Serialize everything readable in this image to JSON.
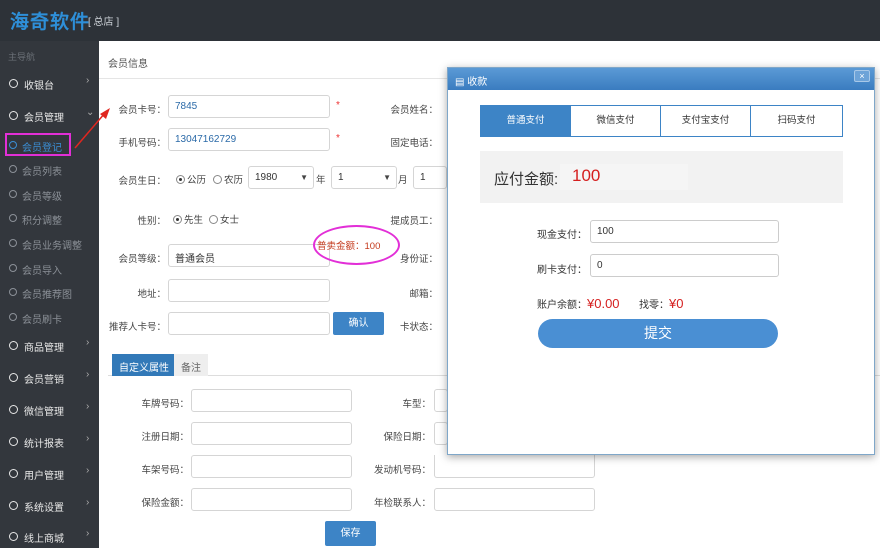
{
  "header": {
    "brand": "海奇软件",
    "store": "[ 总店 ]"
  },
  "sidebar": {
    "title": "主导航",
    "groups": [
      {
        "label": "收银台"
      },
      {
        "label": "会员管理"
      },
      {
        "label": "商品管理"
      },
      {
        "label": "会员营销"
      },
      {
        "label": "微信管理"
      },
      {
        "label": "统计报表"
      },
      {
        "label": "用户管理"
      },
      {
        "label": "系统设置"
      },
      {
        "label": "线上商城"
      }
    ],
    "subitems": [
      {
        "label": "会员登记"
      },
      {
        "label": "会员列表"
      },
      {
        "label": "会员等级"
      },
      {
        "label": "积分调整"
      },
      {
        "label": "会员业务调整"
      },
      {
        "label": "会员导入"
      },
      {
        "label": "会员推荐图"
      },
      {
        "label": "会员刷卡"
      }
    ]
  },
  "main": {
    "section_title": "会员信息",
    "card_label": "会员卡号：",
    "card_value": "7845",
    "name_label": "会员姓名：",
    "phone_label": "手机号码：",
    "phone_value": "13047162729",
    "tel_label": "固定电话：",
    "required": "*",
    "birthday_label": "会员生日：",
    "cal_solar": "公历",
    "cal_lunar": "农历",
    "year_value": "1980",
    "year_unit": "年",
    "month_value": "1",
    "month_unit": "月",
    "day_value": "1",
    "gender_label": "性别：",
    "male": "先生",
    "female": "女士",
    "staff_label": "提成员工：",
    "level_label": "会员等级：",
    "level_value": "普通会员",
    "preferential": "普卖金额：100",
    "id_label": "身份证：",
    "address_label": "地址：",
    "email_label": "邮箱：",
    "referrer_label": "推荐人卡号：",
    "confirm_btn": "确认",
    "cardstate_label": "卡状态：",
    "tabs": [
      "自定义属性",
      "备注"
    ],
    "custom": {
      "plate_label": "车牌号码：",
      "model_label": "车型：",
      "regdate_label": "注册日期：",
      "insdate_label": "保险日期：",
      "frame_label": "车架号码：",
      "engine_label": "发动机号码：",
      "insamt_label": "保险金额：",
      "contact_label": "年检联系人："
    },
    "save_btn": "保存"
  },
  "payment": {
    "title": "收款",
    "close": "×",
    "tabs": [
      "普通支付",
      "微信支付",
      "支付宝支付",
      "扫码支付"
    ],
    "due_label": "应付金额:",
    "due_value": "100",
    "cash_label": "现金支付：",
    "cash_value": "100",
    "card_label": "刷卡支付：",
    "card_value": "0",
    "balance_label": "账户余额：",
    "balance_value": "¥0.00",
    "change_label": "找零：",
    "change_value": "¥0",
    "submit": "提交"
  }
}
